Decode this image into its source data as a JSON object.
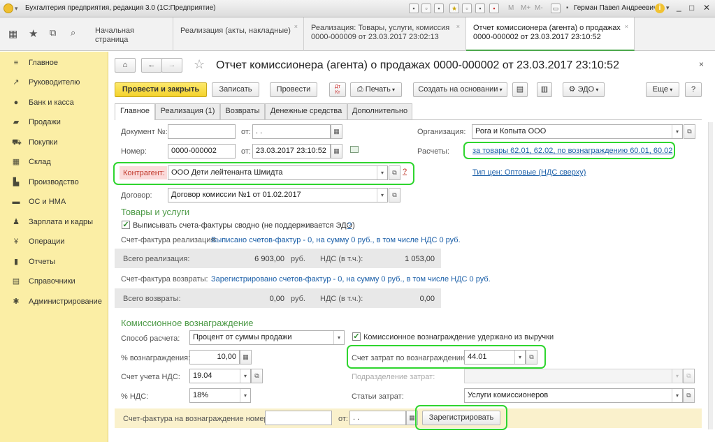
{
  "window": {
    "title": "Бухгалтерия предприятия, редакция 3.0 (1С:Предприятие)",
    "user": "Герман Павел Андреевич",
    "toolbar": [
      "M",
      "M+",
      "M-"
    ]
  },
  "icons": {
    "home": "home-icon",
    "star": "star-icon",
    "history": "history-icon",
    "search": "search-icon",
    "grid": "grid-icon"
  },
  "tabs": [
    {
      "label": "Начальная страница"
    },
    {
      "label": "Реализация (акты, накладные)"
    },
    {
      "line1": "Реализация: Товары, услуги, комиссия",
      "line2": "0000-000009 от 23.03.2017 23:02:13"
    },
    {
      "line1": "Отчет комиссионера (агента) о продажах",
      "line2": "0000-000002 от 23.03.2017 23:10:52"
    }
  ],
  "sidebar": [
    "Главное",
    "Руководителю",
    "Банк и касса",
    "Продажи",
    "Покупки",
    "Склад",
    "Производство",
    "ОС и НМА",
    "Зарплата и кадры",
    "Операции",
    "Отчеты",
    "Справочники",
    "Администрирование"
  ],
  "form": {
    "title": "Отчет комиссионера (агента) о продажах 0000-000002 от 23.03.2017 23:10:52",
    "buttons": {
      "post_close": "Провести и закрыть",
      "save": "Записать",
      "post": "Провести",
      "print": "Печать",
      "create_based": "Создать на основании",
      "edo": "ЭДО",
      "more": "Еще",
      "help": "?"
    },
    "tabs": [
      "Главное",
      "Реализация (1)",
      "Возвраты",
      "Денежные средства",
      "Дополнительно"
    ],
    "fields": {
      "doc_no_label": "Документ №:",
      "from_label": "от:",
      "doc_date_value": " .  .",
      "number_label": "Номер:",
      "number_value": "0000-000002",
      "date_value": "23.03.2017 23:10:52",
      "org_label": "Организация:",
      "org_value": "Рога и Копыта ООО",
      "settlements_label": "Расчеты:",
      "settlements_link": "за товары 62.01, 62.02, по вознаграждению 60.01, 60.02",
      "contractor_label": "Контрагент:",
      "contractor_value": "ООО Дети лейтенанта Шмидта",
      "contract_label": "Договор:",
      "contract_value": "Договор комиссии №1 от 01.02.2017",
      "price_type_link": "Тип цен: Оптовые (НДС сверху)"
    },
    "goods": {
      "heading": "Товары и услуги",
      "checkbox": "Выписывать счета-фактуры сводно (не поддерживается ЭДО)",
      "q": "?",
      "invoice_sales_label": "Счет-фактура реализация:",
      "invoice_sales_link": "Выписано счетов-фактур - 0, на сумму 0 руб., в том числе НДС 0 руб.",
      "total_sales_label": "Всего реализация:",
      "total_sales_value": "6 903,00",
      "total_sales_vat_value": "1 053,00",
      "invoice_returns_label": "Счет-фактура возвраты:",
      "invoice_returns_link": "Зарегистрировано счетов-фактур - 0, на сумму 0 руб., в том числе НДС 0 руб.",
      "total_returns_label": "Всего возвраты:",
      "total_returns_value": "0,00",
      "total_returns_vat_value": "0,00",
      "rub": "руб.",
      "vat_label": "НДС (в т.ч.):"
    },
    "commission": {
      "heading": "Комиссионное вознаграждение",
      "method_label": "Способ расчета:",
      "method_value": "Процент от суммы продажи",
      "withheld_label": "Комиссионное вознаграждение удержано из выручки",
      "percent_label": "% вознаграждения:",
      "percent_value": "10,00",
      "cost_account_label": "Счет затрат по вознаграждению:",
      "cost_account_value": "44.01",
      "vat_account_label": "Счет учета НДС:",
      "vat_account_value": "19.04",
      "cost_division_label": "Подразделение затрат:",
      "vat_rate_label": "% НДС:",
      "vat_rate_value": "18%",
      "cost_items_label": "Статьи затрат:",
      "cost_items_value": "Услуги комиссионеров",
      "invoice_label": "Счет-фактура на вознаграждение номер:",
      "invoice_from": "от:",
      "invoice_date": " .  .",
      "register_button": "Зарегистрировать"
    }
  }
}
